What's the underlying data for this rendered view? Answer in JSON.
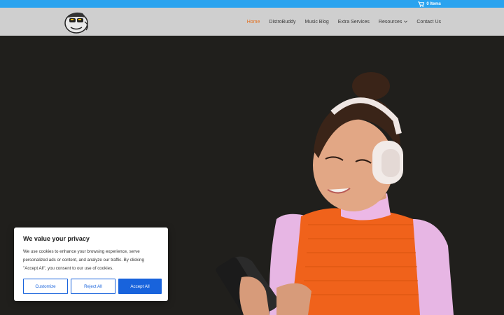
{
  "topbar": {
    "cart_label": "0 Items"
  },
  "nav": {
    "items": [
      {
        "label": "Home"
      },
      {
        "label": "DistroBuddy"
      },
      {
        "label": "Music Blog"
      },
      {
        "label": "Extra Services"
      },
      {
        "label": "Resources"
      },
      {
        "label": "Contact Us"
      }
    ],
    "active_color": "#e3701f"
  },
  "cookie_banner": {
    "title": "We value your privacy",
    "body": "We use cookies to enhance your browsing experience, serve personalized ads or content, and analyze our traffic. By clicking \"Accept All\", you consent to our use of cookies.",
    "customize_label": "Customize",
    "reject_label": "Reject All",
    "accept_label": "Accept All",
    "accent_color": "#1863dc"
  },
  "colors": {
    "topbar": "#2aa3ef",
    "header": "#cfcfcf",
    "hero_bg": "#201f1c"
  }
}
